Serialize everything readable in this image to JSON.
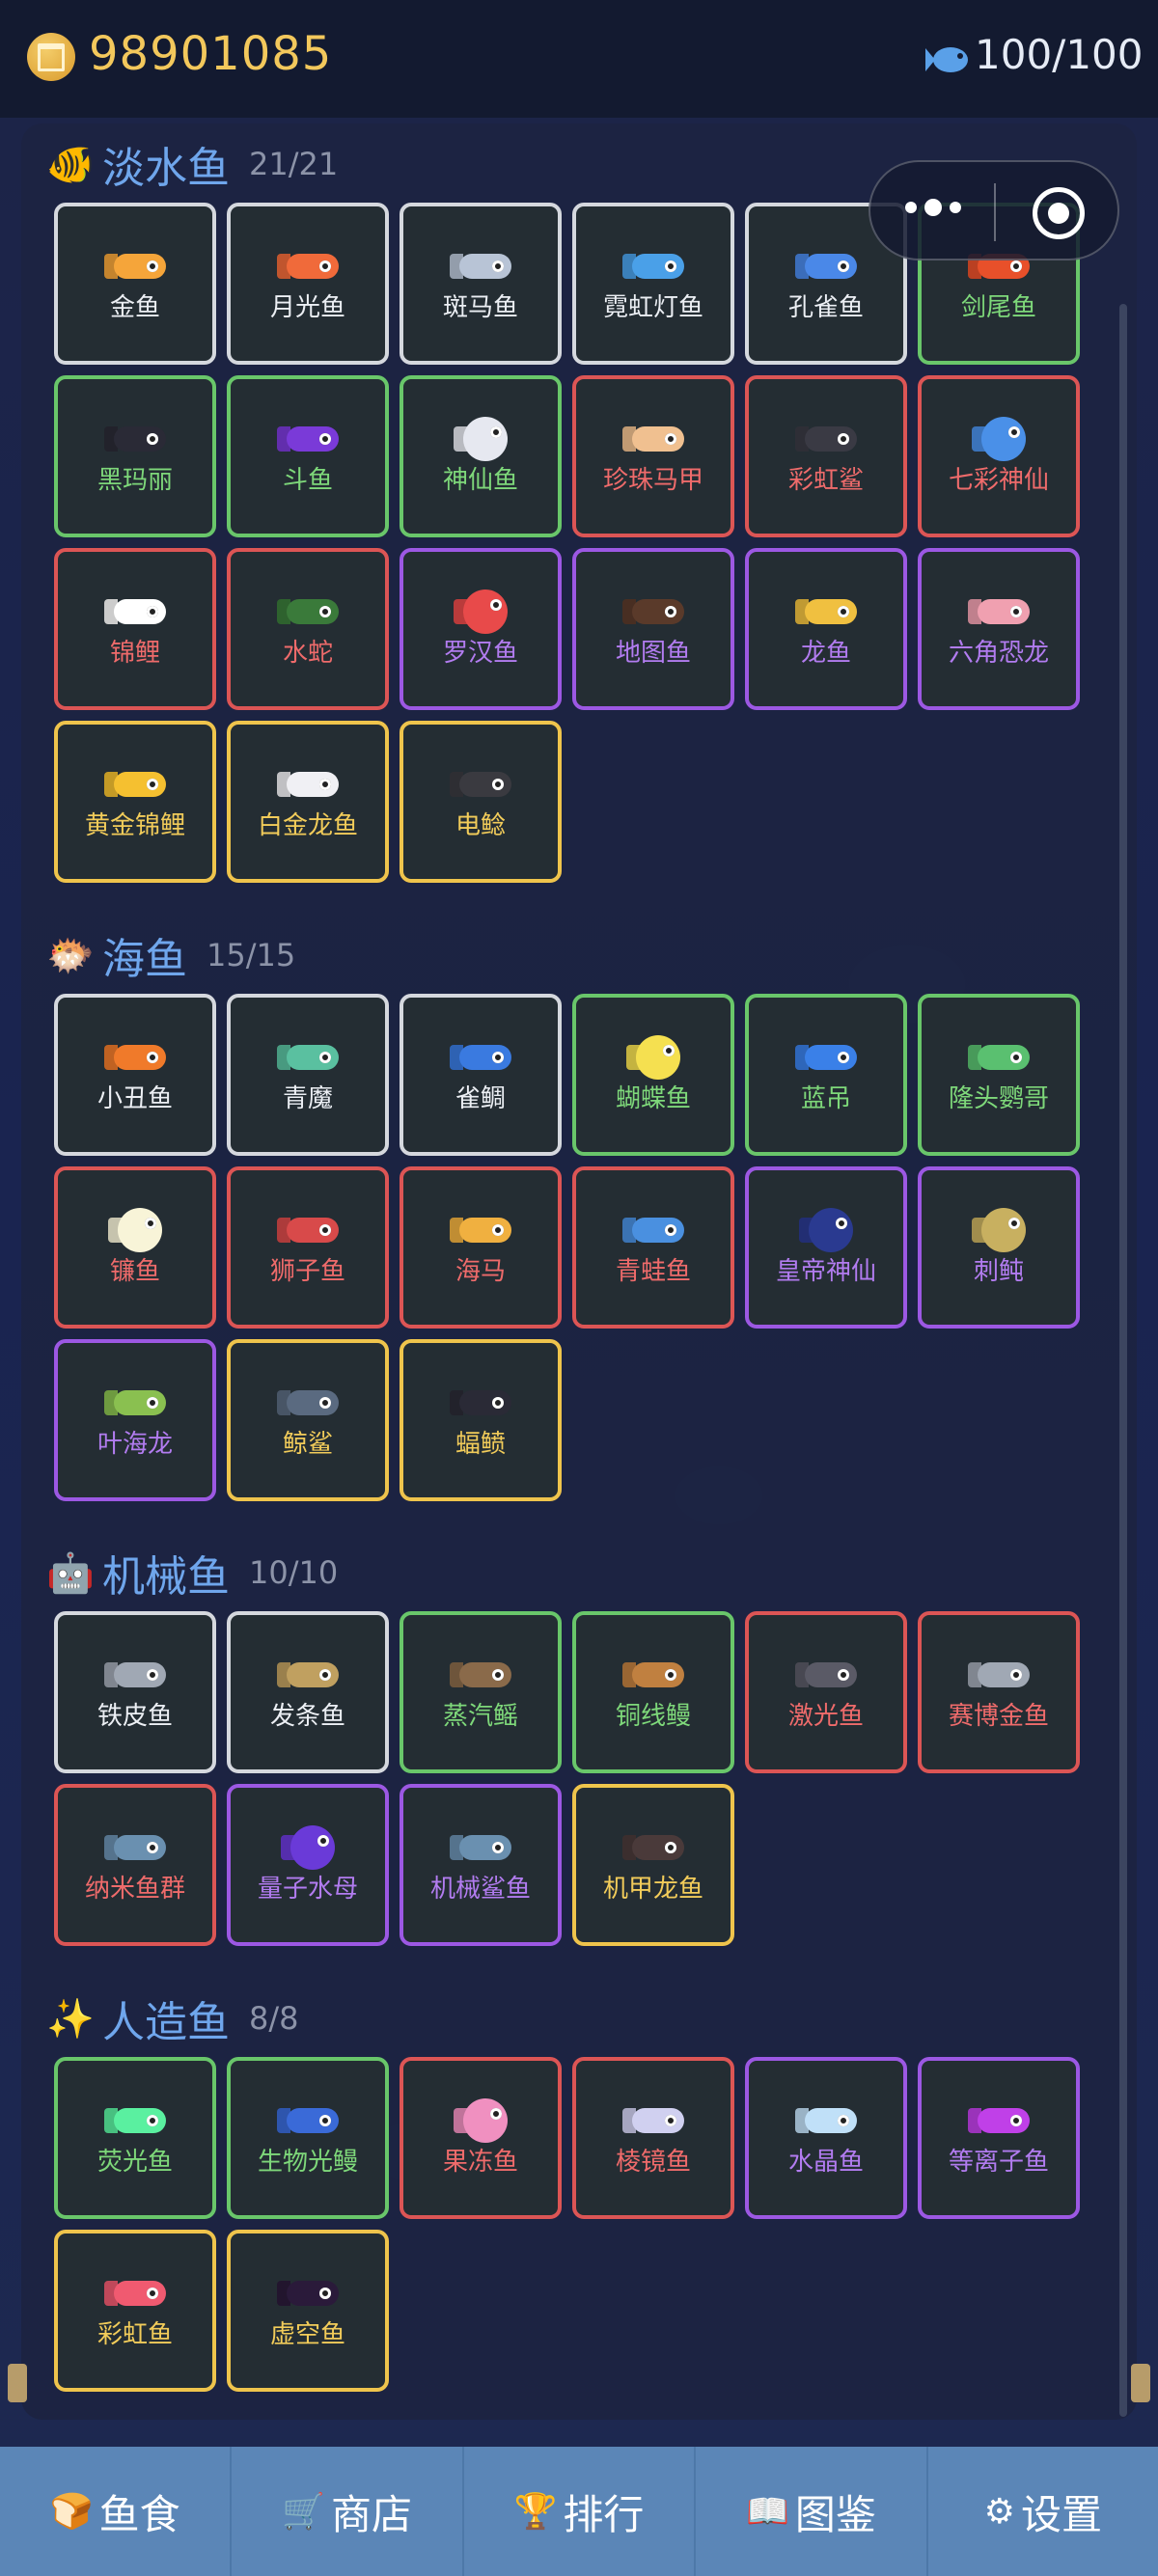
{
  "header": {
    "coins": "98901085",
    "fish_count": "100/100"
  },
  "colors": {
    "white": "#d5d8de",
    "green": "#69c66a",
    "red": "#dc5555",
    "purple": "#9c58e3",
    "gold": "#efc44c",
    "section_title": "#6fa6ec",
    "nav_bg": "#5b86b7"
  },
  "sections": [
    {
      "emoji": "🐠",
      "title": "淡水鱼",
      "count": "21/21",
      "fish": [
        {
          "name": "金鱼",
          "rarity": "white",
          "color": "#f5a53a",
          "shape": "long"
        },
        {
          "name": "月光鱼",
          "rarity": "white",
          "color": "#f06a3a",
          "shape": "long"
        },
        {
          "name": "斑马鱼",
          "rarity": "white",
          "color": "#b8c4d6",
          "shape": "long"
        },
        {
          "name": "霓虹灯鱼",
          "rarity": "white",
          "color": "#4aa0e8",
          "shape": "long"
        },
        {
          "name": "孔雀鱼",
          "rarity": "white",
          "color": "#4a88e8",
          "shape": "long"
        },
        {
          "name": "剑尾鱼",
          "rarity": "green",
          "color": "#e8502a",
          "shape": "long"
        },
        {
          "name": "黑玛丽",
          "rarity": "green",
          "color": "#2a2a36",
          "shape": "long"
        },
        {
          "name": "斗鱼",
          "rarity": "green",
          "color": "#7a3ad8",
          "shape": "long"
        },
        {
          "name": "神仙鱼",
          "rarity": "green",
          "color": "#e6e8f0",
          "shape": "round"
        },
        {
          "name": "珍珠马甲",
          "rarity": "red",
          "color": "#f0c090",
          "shape": "long"
        },
        {
          "name": "彩虹鲨",
          "rarity": "red",
          "color": "#3a3a44",
          "shape": "long"
        },
        {
          "name": "七彩神仙",
          "rarity": "red",
          "color": "#4a90e8",
          "shape": "round"
        },
        {
          "name": "锦鲤",
          "rarity": "red",
          "color": "#ffffff",
          "shape": "long"
        },
        {
          "name": "水蛇",
          "rarity": "red",
          "color": "#3a7a3a",
          "shape": "long"
        },
        {
          "name": "罗汉鱼",
          "rarity": "purple",
          "color": "#e84a4a",
          "shape": "round"
        },
        {
          "name": "地图鱼",
          "rarity": "purple",
          "color": "#5a3a2a",
          "shape": "long"
        },
        {
          "name": "龙鱼",
          "rarity": "purple",
          "color": "#f0c040",
          "shape": "long"
        },
        {
          "name": "六角恐龙",
          "rarity": "purple",
          "color": "#f0a0b0",
          "shape": "long"
        },
        {
          "name": "黄金锦鲤",
          "rarity": "gold",
          "color": "#f5c030",
          "shape": "long"
        },
        {
          "name": "白金龙鱼",
          "rarity": "gold",
          "color": "#f0f0f4",
          "shape": "long"
        },
        {
          "name": "电鲶",
          "rarity": "gold",
          "color": "#3a3a40",
          "shape": "long"
        }
      ]
    },
    {
      "emoji": "🐡",
      "title": "海鱼",
      "count": "15/15",
      "fish": [
        {
          "name": "小丑鱼",
          "rarity": "white",
          "color": "#f07a2a",
          "shape": "long"
        },
        {
          "name": "青魔",
          "rarity": "white",
          "color": "#5ac0a0",
          "shape": "long"
        },
        {
          "name": "雀鲷",
          "rarity": "white",
          "color": "#3a7ae0",
          "shape": "long"
        },
        {
          "name": "蝴蝶鱼",
          "rarity": "green",
          "color": "#f5e050",
          "shape": "round"
        },
        {
          "name": "蓝吊",
          "rarity": "green",
          "color": "#3a80e8",
          "shape": "long"
        },
        {
          "name": "隆头鹦哥",
          "rarity": "green",
          "color": "#5ac070",
          "shape": "long"
        },
        {
          "name": "镰鱼",
          "rarity": "red",
          "color": "#f8f4d8",
          "shape": "round"
        },
        {
          "name": "狮子鱼",
          "rarity": "red",
          "color": "#d84a4a",
          "shape": "long"
        },
        {
          "name": "海马",
          "rarity": "red",
          "color": "#f0b040",
          "shape": "long"
        },
        {
          "name": "青蛙鱼",
          "rarity": "red",
          "color": "#4a90e0",
          "shape": "long"
        },
        {
          "name": "皇帝神仙",
          "rarity": "purple",
          "color": "#2a3a90",
          "shape": "round"
        },
        {
          "name": "刺鲀",
          "rarity": "purple",
          "color": "#c8b060",
          "shape": "round"
        },
        {
          "name": "叶海龙",
          "rarity": "purple",
          "color": "#8ac050",
          "shape": "long"
        },
        {
          "name": "鲸鲨",
          "rarity": "gold",
          "color": "#5a6a80",
          "shape": "long"
        },
        {
          "name": "蝠鲼",
          "rarity": "gold",
          "color": "#2a2a36",
          "shape": "long"
        }
      ]
    },
    {
      "emoji": "🤖",
      "title": "机械鱼",
      "count": "10/10",
      "fish": [
        {
          "name": "铁皮鱼",
          "rarity": "white",
          "color": "#a0a8b4",
          "shape": "long"
        },
        {
          "name": "发条鱼",
          "rarity": "white",
          "color": "#c0a060",
          "shape": "long"
        },
        {
          "name": "蒸汽鳐",
          "rarity": "green",
          "color": "#8a6a4a",
          "shape": "long"
        },
        {
          "name": "铜线鳗",
          "rarity": "green",
          "color": "#c08040",
          "shape": "long"
        },
        {
          "name": "激光鱼",
          "rarity": "red",
          "color": "#5a5a66",
          "shape": "long"
        },
        {
          "name": "赛博金鱼",
          "rarity": "red",
          "color": "#a0a8b4",
          "shape": "long"
        },
        {
          "name": "纳米鱼群",
          "rarity": "red",
          "color": "#6a90b0",
          "shape": "long"
        },
        {
          "name": "量子水母",
          "rarity": "purple",
          "color": "#6a3ad8",
          "shape": "round"
        },
        {
          "name": "机械鲨鱼",
          "rarity": "purple",
          "color": "#6a90b0",
          "shape": "long"
        },
        {
          "name": "机甲龙鱼",
          "rarity": "gold",
          "color": "#4a3a3a",
          "shape": "long"
        }
      ]
    },
    {
      "emoji": "✨",
      "title": "人造鱼",
      "count": "8/8",
      "fish": [
        {
          "name": "荧光鱼",
          "rarity": "green",
          "color": "#5af0a0",
          "shape": "long"
        },
        {
          "name": "生物光鳗",
          "rarity": "green",
          "color": "#3a6ad8",
          "shape": "long"
        },
        {
          "name": "果冻鱼",
          "rarity": "red",
          "color": "#f090c0",
          "shape": "round"
        },
        {
          "name": "棱镜鱼",
          "rarity": "red",
          "color": "#d0d0f0",
          "shape": "long"
        },
        {
          "name": "水晶鱼",
          "rarity": "purple",
          "color": "#c0e0f8",
          "shape": "long"
        },
        {
          "name": "等离子鱼",
          "rarity": "purple",
          "color": "#c040e8",
          "shape": "long"
        },
        {
          "name": "彩虹鱼",
          "rarity": "gold",
          "color": "#f05a70",
          "shape": "long"
        },
        {
          "name": "虚空鱼",
          "rarity": "gold",
          "color": "#2a1a3a",
          "shape": "long"
        }
      ]
    }
  ],
  "nav": [
    {
      "icon": "bread-icon",
      "glyph": "🍞",
      "label": "鱼食"
    },
    {
      "icon": "cart-icon",
      "glyph": "🛒",
      "label": "商店"
    },
    {
      "icon": "trophy-icon",
      "glyph": "🏆",
      "label": "排行"
    },
    {
      "icon": "book-icon",
      "glyph": "📖",
      "label": "图鉴"
    },
    {
      "icon": "gear-icon",
      "glyph": "⚙",
      "label": "设置"
    }
  ]
}
